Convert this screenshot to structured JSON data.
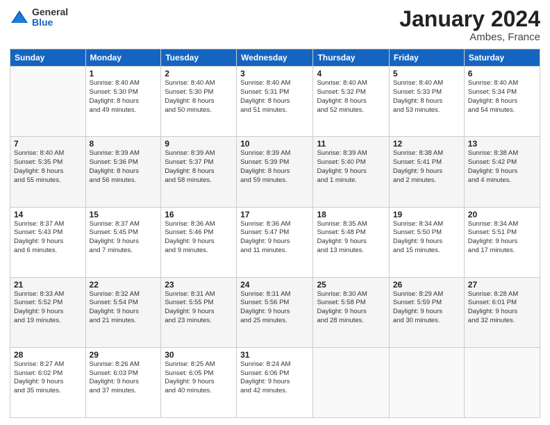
{
  "logo": {
    "general": "General",
    "blue": "Blue"
  },
  "header": {
    "month": "January 2024",
    "location": "Ambes, France"
  },
  "weekdays": [
    "Sunday",
    "Monday",
    "Tuesday",
    "Wednesday",
    "Thursday",
    "Friday",
    "Saturday"
  ],
  "weeks": [
    [
      {
        "day": "",
        "info": ""
      },
      {
        "day": "1",
        "info": "Sunrise: 8:40 AM\nSunset: 5:30 PM\nDaylight: 8 hours\nand 49 minutes."
      },
      {
        "day": "2",
        "info": "Sunrise: 8:40 AM\nSunset: 5:30 PM\nDaylight: 8 hours\nand 50 minutes."
      },
      {
        "day": "3",
        "info": "Sunrise: 8:40 AM\nSunset: 5:31 PM\nDaylight: 8 hours\nand 51 minutes."
      },
      {
        "day": "4",
        "info": "Sunrise: 8:40 AM\nSunset: 5:32 PM\nDaylight: 8 hours\nand 52 minutes."
      },
      {
        "day": "5",
        "info": "Sunrise: 8:40 AM\nSunset: 5:33 PM\nDaylight: 8 hours\nand 53 minutes."
      },
      {
        "day": "6",
        "info": "Sunrise: 8:40 AM\nSunset: 5:34 PM\nDaylight: 8 hours\nand 54 minutes."
      }
    ],
    [
      {
        "day": "7",
        "info": "Sunrise: 8:40 AM\nSunset: 5:35 PM\nDaylight: 8 hours\nand 55 minutes."
      },
      {
        "day": "8",
        "info": "Sunrise: 8:39 AM\nSunset: 5:36 PM\nDaylight: 8 hours\nand 56 minutes."
      },
      {
        "day": "9",
        "info": "Sunrise: 8:39 AM\nSunset: 5:37 PM\nDaylight: 8 hours\nand 58 minutes."
      },
      {
        "day": "10",
        "info": "Sunrise: 8:39 AM\nSunset: 5:39 PM\nDaylight: 8 hours\nand 59 minutes."
      },
      {
        "day": "11",
        "info": "Sunrise: 8:39 AM\nSunset: 5:40 PM\nDaylight: 9 hours\nand 1 minute."
      },
      {
        "day": "12",
        "info": "Sunrise: 8:38 AM\nSunset: 5:41 PM\nDaylight: 9 hours\nand 2 minutes."
      },
      {
        "day": "13",
        "info": "Sunrise: 8:38 AM\nSunset: 5:42 PM\nDaylight: 9 hours\nand 4 minutes."
      }
    ],
    [
      {
        "day": "14",
        "info": "Sunrise: 8:37 AM\nSunset: 5:43 PM\nDaylight: 9 hours\nand 6 minutes."
      },
      {
        "day": "15",
        "info": "Sunrise: 8:37 AM\nSunset: 5:45 PM\nDaylight: 9 hours\nand 7 minutes."
      },
      {
        "day": "16",
        "info": "Sunrise: 8:36 AM\nSunset: 5:46 PM\nDaylight: 9 hours\nand 9 minutes."
      },
      {
        "day": "17",
        "info": "Sunrise: 8:36 AM\nSunset: 5:47 PM\nDaylight: 9 hours\nand 11 minutes."
      },
      {
        "day": "18",
        "info": "Sunrise: 8:35 AM\nSunset: 5:48 PM\nDaylight: 9 hours\nand 13 minutes."
      },
      {
        "day": "19",
        "info": "Sunrise: 8:34 AM\nSunset: 5:50 PM\nDaylight: 9 hours\nand 15 minutes."
      },
      {
        "day": "20",
        "info": "Sunrise: 8:34 AM\nSunset: 5:51 PM\nDaylight: 9 hours\nand 17 minutes."
      }
    ],
    [
      {
        "day": "21",
        "info": "Sunrise: 8:33 AM\nSunset: 5:52 PM\nDaylight: 9 hours\nand 19 minutes."
      },
      {
        "day": "22",
        "info": "Sunrise: 8:32 AM\nSunset: 5:54 PM\nDaylight: 9 hours\nand 21 minutes."
      },
      {
        "day": "23",
        "info": "Sunrise: 8:31 AM\nSunset: 5:55 PM\nDaylight: 9 hours\nand 23 minutes."
      },
      {
        "day": "24",
        "info": "Sunrise: 8:31 AM\nSunset: 5:56 PM\nDaylight: 9 hours\nand 25 minutes."
      },
      {
        "day": "25",
        "info": "Sunrise: 8:30 AM\nSunset: 5:58 PM\nDaylight: 9 hours\nand 28 minutes."
      },
      {
        "day": "26",
        "info": "Sunrise: 8:29 AM\nSunset: 5:59 PM\nDaylight: 9 hours\nand 30 minutes."
      },
      {
        "day": "27",
        "info": "Sunrise: 8:28 AM\nSunset: 6:01 PM\nDaylight: 9 hours\nand 32 minutes."
      }
    ],
    [
      {
        "day": "28",
        "info": "Sunrise: 8:27 AM\nSunset: 6:02 PM\nDaylight: 9 hours\nand 35 minutes."
      },
      {
        "day": "29",
        "info": "Sunrise: 8:26 AM\nSunset: 6:03 PM\nDaylight: 9 hours\nand 37 minutes."
      },
      {
        "day": "30",
        "info": "Sunrise: 8:25 AM\nSunset: 6:05 PM\nDaylight: 9 hours\nand 40 minutes."
      },
      {
        "day": "31",
        "info": "Sunrise: 8:24 AM\nSunset: 6:06 PM\nDaylight: 9 hours\nand 42 minutes."
      },
      {
        "day": "",
        "info": ""
      },
      {
        "day": "",
        "info": ""
      },
      {
        "day": "",
        "info": ""
      }
    ]
  ]
}
